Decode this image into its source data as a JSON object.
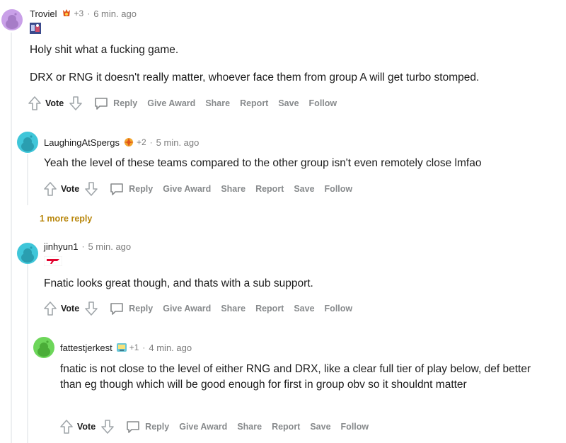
{
  "comments": [
    {
      "username": "Troviel",
      "plus": "+3",
      "time": "6 min. ago",
      "paragraphs": [
        "Holy shit what a fucking game.",
        "DRX or RNG it doesn't really matter, whoever face them from group A will get turbo stomped."
      ]
    },
    {
      "username": "LaughingAtSpergs",
      "plus": "+2",
      "time": "5 min. ago",
      "paragraphs": [
        "Yeah the level of these teams compared to the other group isn't even remotely close lmfao"
      ]
    },
    {
      "username": "jinhyun1",
      "time": "5 min. ago",
      "paragraphs": [
        "Fnatic looks great though, and thats with a sub support."
      ]
    },
    {
      "username": "fattestjerkest",
      "plus": "+1",
      "time": "4 min. ago",
      "paragraphs": [
        "fnatic is not close to the level of either RNG and DRX, like a clear full tier of play below, def better than eg though which will be good enough for first in group obv so it shouldnt matter"
      ]
    }
  ],
  "actions": {
    "vote": "Vote",
    "reply": "Reply",
    "give_award": "Give Award",
    "share": "Share",
    "report": "Report",
    "save": "Save",
    "follow": "Follow"
  },
  "more_replies": "1 more reply",
  "colors": {
    "avatar_purple": "#c9a0e8",
    "avatar_cyan": "#3fc6d9",
    "avatar_green": "#6dd65a",
    "more_reply": "#b8860b"
  },
  "icons": [
    "upvote-icon",
    "downvote-icon",
    "comment-bubble-icon",
    "snoo-avatar-icon",
    "flair-icon"
  ]
}
